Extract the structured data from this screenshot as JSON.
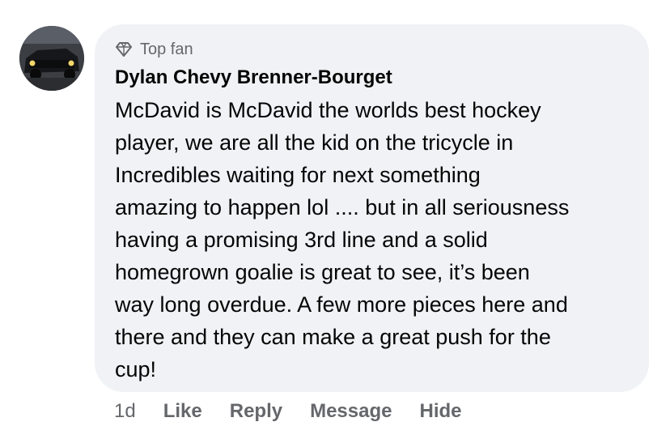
{
  "comment": {
    "badge": {
      "label": "Top fan",
      "icon": "diamond-icon"
    },
    "author": "Dylan Chevy Brenner-Bourget",
    "text": "McDavid is McDavid the worlds best hockey\nplayer, we are all the kid on the tricycle in\nIncredibles waiting for next something\namazing to happen lol .... but in all seriousness\nhaving a promising 3rd line and a solid\nhomegrown goalie is great to see, it’s been\nway long overdue. A few more pieces here and\nthere and they can make a great push for the\ncup!",
    "time": "1d",
    "actions": {
      "like": "Like",
      "reply": "Reply",
      "message": "Message",
      "hide": "Hide"
    }
  },
  "colors": {
    "bubble": "#f0f2f5",
    "secondary_text": "#65676b",
    "primary_text": "#050505"
  }
}
